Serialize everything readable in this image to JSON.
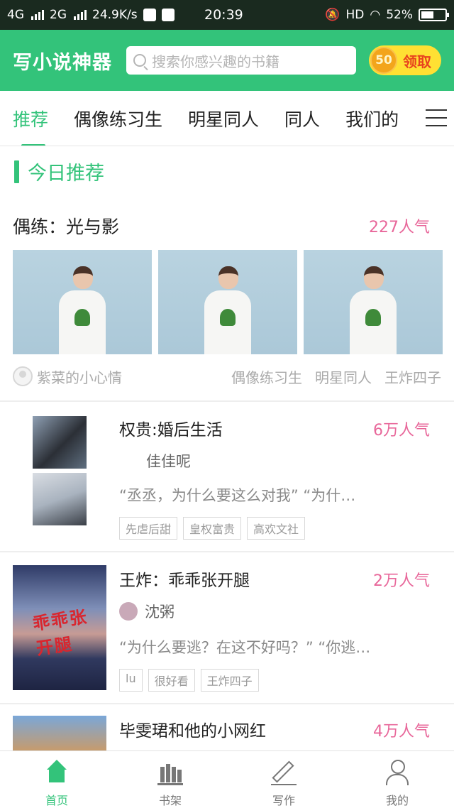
{
  "status_bar": {
    "network1": "4G",
    "network2": "2G",
    "speed": "24.9K/s",
    "time": "20:39",
    "hd": "HD",
    "battery": "52%"
  },
  "header": {
    "app_title": "写小说神器",
    "search_placeholder": "搜索你感兴趣的书籍",
    "coin_count": "50",
    "claim_label": "领取"
  },
  "tabs": [
    "推荐",
    "偶像练习生",
    "明星同人",
    "同人",
    "我们的"
  ],
  "active_tab": 0,
  "section": {
    "title": "今日推荐"
  },
  "featured": {
    "title": "偶练：光与影",
    "popularity": "227人气",
    "author": "紫菜的小心情",
    "tags": [
      "偶像练习生",
      "明星同人",
      "王炸四子"
    ]
  },
  "books": [
    {
      "title": "权贵:婚后生活",
      "popularity": "6万人气",
      "author": "佳佳呢",
      "excerpt": "“丞丞，为什么要这么对我” “为什…",
      "tags": [
        "先虐后甜",
        "皇权富贵",
        "高欢文社"
      ]
    },
    {
      "title": "王炸：乖乖张开腿",
      "popularity": "2万人气",
      "author": "沈粥",
      "excerpt": "“为什么要逃？在这不好吗？” “你逃…",
      "tags": [
        "lu",
        "很好看",
        "王炸四子"
      ],
      "cover_text": "乖乖张开腿"
    },
    {
      "title": "毕雯珺和他的小网红",
      "popularity": "4万人气"
    }
  ],
  "bottom_nav": [
    {
      "label": "首页",
      "icon": "home-icon"
    },
    {
      "label": "书架",
      "icon": "bookshelf-icon"
    },
    {
      "label": "写作",
      "icon": "pen-icon"
    },
    {
      "label": "我的",
      "icon": "user-icon"
    }
  ],
  "colors": {
    "accent": "#33c37a",
    "popularity": "#e8679a",
    "claim_bg": "#ffe033",
    "claim_text": "#e8431e"
  }
}
